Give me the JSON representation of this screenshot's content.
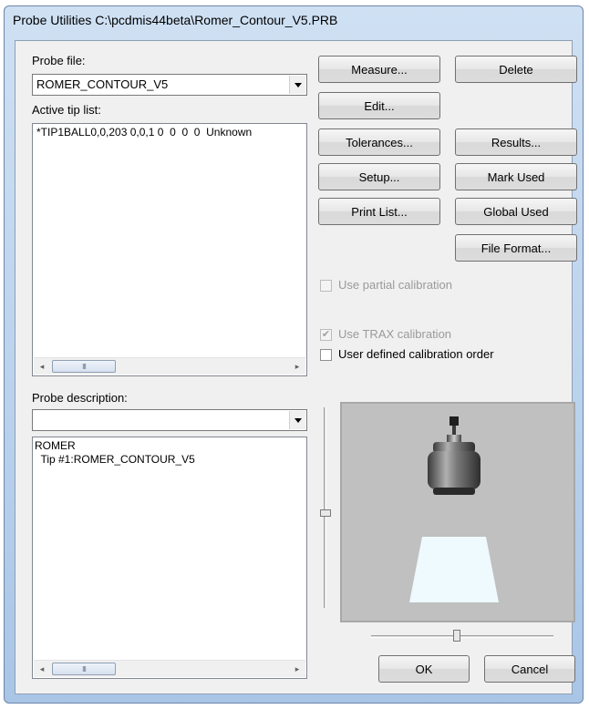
{
  "window": {
    "title": "Probe Utilities  C:\\pcdmis44beta\\Romer_Contour_V5.PRB"
  },
  "probe_file": {
    "label": "Probe file:",
    "value": "ROMER_CONTOUR_V5"
  },
  "active_tip": {
    "label": "Active tip list:",
    "items": [
      "*TIP1BALL0,0,203 0,0,1 0  0  0  0  Unknown"
    ]
  },
  "probe_description": {
    "label": "Probe description:",
    "combo_value": "",
    "lines": [
      "ROMER",
      "  Tip #1:ROMER_CONTOUR_V5"
    ]
  },
  "buttons": {
    "measure": "Measure...",
    "delete": "Delete",
    "edit": "Edit...",
    "tolerances": "Tolerances...",
    "results": "Results...",
    "setup": "Setup...",
    "mark_used": "Mark Used",
    "print_list": "Print List...",
    "global_used": "Global Used",
    "file_format": "File Format...",
    "ok": "OK",
    "cancel": "Cancel"
  },
  "options": {
    "partial_calibration": {
      "label": "Use partial calibration",
      "checked": false,
      "enabled": false
    },
    "trax_calibration": {
      "label": "Use TRAX calibration",
      "checked": true,
      "enabled": false
    },
    "user_defined_order": {
      "label": "User defined calibration order",
      "checked": false,
      "enabled": true
    }
  },
  "scroll": {
    "thumb_glyph": "III",
    "left_arrow": "◂",
    "right_arrow": "▸"
  },
  "colors": {
    "title_bar": "#b9d1ec",
    "dialog_bg": "#f0f0f0",
    "preview_bg": "#c0c0c0",
    "probe_beam": "#e8f7fb"
  }
}
